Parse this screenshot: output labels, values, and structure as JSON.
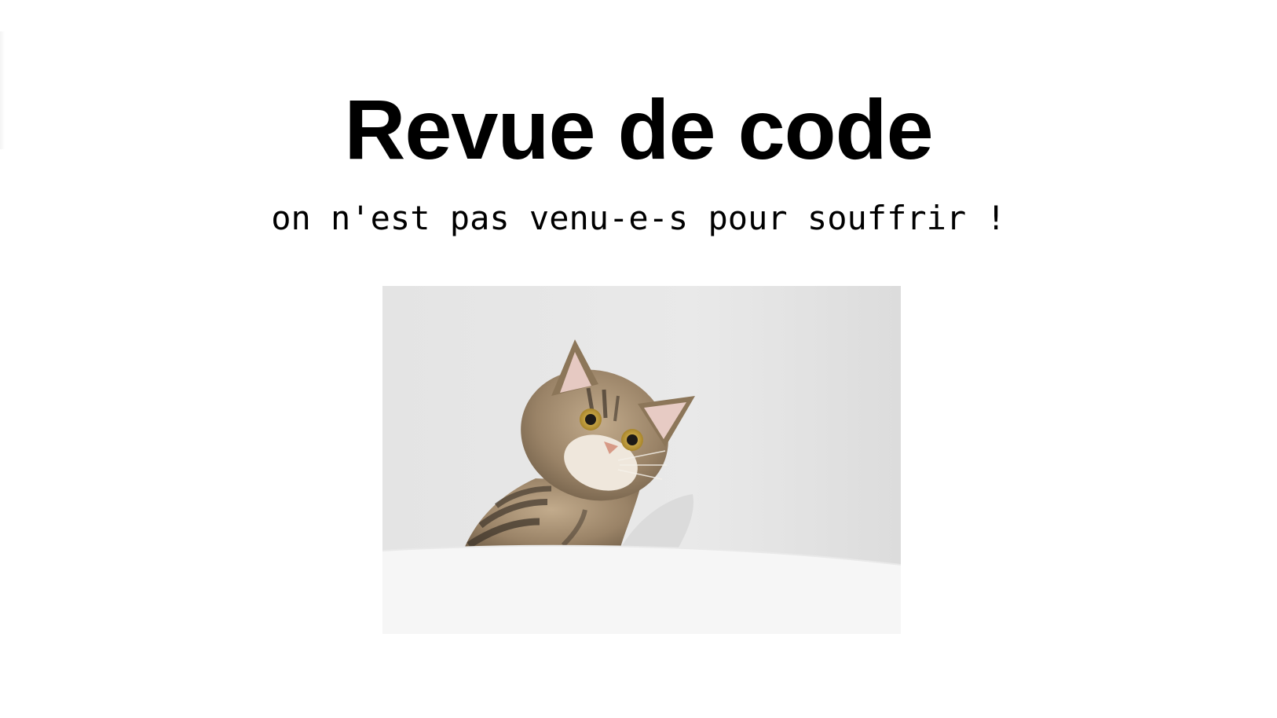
{
  "slide": {
    "title": "Revue de code",
    "subtitle": "on n'est pas venu-e-s pour souffrir !"
  },
  "image": {
    "subject": "cat-photo",
    "colors": {
      "wall": "#e6e6e6",
      "table": "#f6f6f6",
      "fur": "#9a8367",
      "stripes": "#3f352b",
      "eyes": "#c9a43a",
      "nose": "#d79a86"
    }
  }
}
